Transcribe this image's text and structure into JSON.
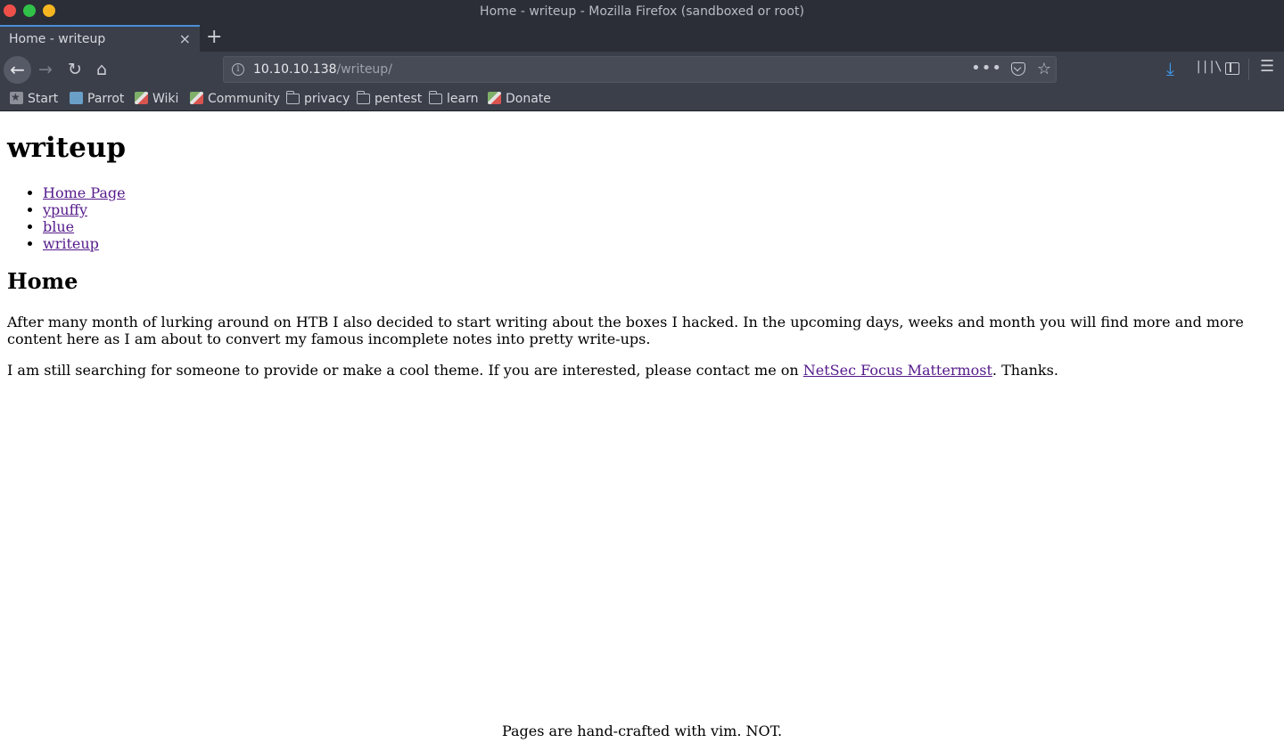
{
  "window": {
    "title": "Home - writeup - Mozilla Firefox (sandboxed or root)"
  },
  "tabs": [
    {
      "label": "Home - writeup",
      "close_glyph": "×"
    }
  ],
  "new_tab_glyph": "+",
  "nav": {
    "back_glyph": "←",
    "forward_glyph": "→",
    "reload_glyph": "↻",
    "home_glyph": "⌂"
  },
  "urlbar": {
    "host": "10.10.10.138",
    "path": "/writeup/",
    "info_glyph": "i",
    "more_glyph": "•••",
    "star_glyph": "☆"
  },
  "toolbar": {
    "download_glyph": "⤓",
    "library_glyph": "|||\\",
    "menu_glyph": "☰"
  },
  "bookmarks": [
    {
      "label": "Start",
      "icon": "start-star-icon"
    },
    {
      "label": "Parrot",
      "icon": "parrot-icon"
    },
    {
      "label": "Wiki",
      "icon": "wiki-icon"
    },
    {
      "label": "Community",
      "icon": "community-icon"
    },
    {
      "label": "privacy",
      "icon": "folder-icon"
    },
    {
      "label": "pentest",
      "icon": "folder-icon"
    },
    {
      "label": "learn",
      "icon": "folder-icon"
    },
    {
      "label": "Donate",
      "icon": "donate-icon"
    }
  ],
  "page": {
    "site_title": "writeup",
    "menu": [
      "Home Page",
      "ypuffy",
      "blue",
      "writeup"
    ],
    "heading": "Home",
    "paragraph1": "After many month of lurking around on HTB I also decided to start writing about the boxes I hacked. In the upcoming days, weeks and month you will find more and more content here as I am about to convert my famous incomplete notes into pretty write-ups.",
    "paragraph2_before": "I am still searching for someone to provide or make a cool theme. If you are interested, please contact me on ",
    "paragraph2_link": "NetSec Focus Mattermost",
    "paragraph2_after": ". Thanks.",
    "footer": "Pages are hand-crafted with vim. NOT."
  },
  "colors": {
    "chrome_dark": "#2b2e37",
    "chrome": "#3b3f4a",
    "tab_accent": "#4a90d9",
    "link_visited": "#551a8b",
    "download_blue": "#3d9bf0"
  }
}
